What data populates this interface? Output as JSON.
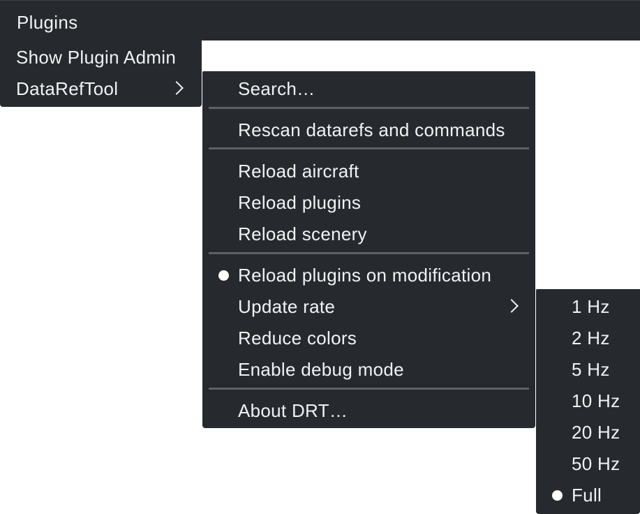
{
  "menubar": {
    "title": "Plugins"
  },
  "plugins_menu": {
    "items": [
      {
        "label": "Show Plugin Admin"
      },
      {
        "label": "DataRefTool",
        "has_submenu": true
      }
    ]
  },
  "datareftool_menu": {
    "items": [
      {
        "label": "Search…"
      },
      {
        "label": "Rescan datarefs and commands"
      },
      {
        "label": "Reload aircraft"
      },
      {
        "label": "Reload plugins"
      },
      {
        "label": "Reload scenery"
      },
      {
        "label": "Reload plugins on modification",
        "checked": true
      },
      {
        "label": "Update rate",
        "has_submenu": true
      },
      {
        "label": "Reduce colors"
      },
      {
        "label": "Enable debug mode"
      },
      {
        "label": "About DRT…"
      }
    ]
  },
  "update_rate_menu": {
    "items": [
      {
        "label": "1 Hz"
      },
      {
        "label": "2 Hz"
      },
      {
        "label": "5 Hz"
      },
      {
        "label": "10 Hz"
      },
      {
        "label": "20 Hz"
      },
      {
        "label": "50 Hz"
      },
      {
        "label": "Full",
        "checked": true
      }
    ]
  },
  "theme": {
    "menu_background": "#262a2f",
    "text_color": "#f2f2f2",
    "divider_color": "#5d6168",
    "page_background": "#ffffff"
  }
}
